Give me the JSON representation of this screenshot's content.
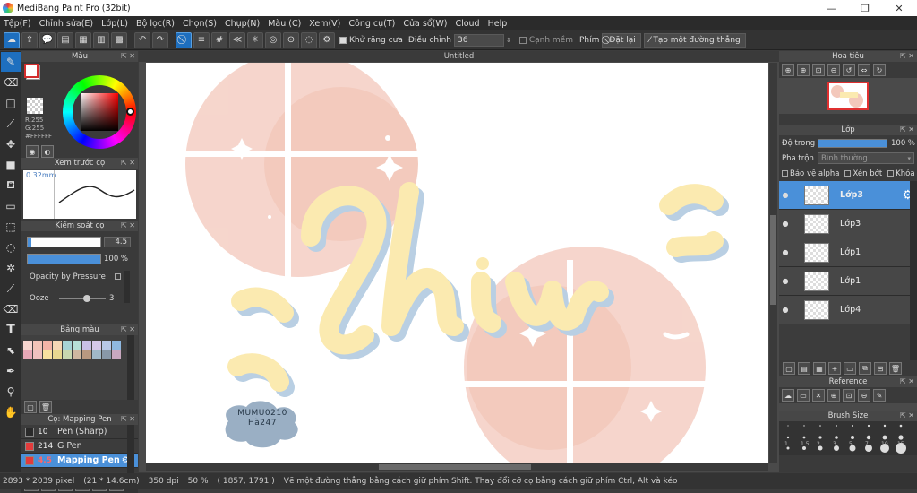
{
  "app": {
    "title": "MediBang Paint Pro (32bit)"
  },
  "menu": [
    "Tệp(F)",
    "Chỉnh sửa(E)",
    "Lớp(L)",
    "Bộ lọc(R)",
    "Chọn(S)",
    "Chụp(N)",
    "Màu (C)",
    "Xem(V)",
    "Công cụ(T)",
    "Cửa sổ(W)",
    "Cloud",
    "Help"
  ],
  "toolbar": {
    "antialias_label": "Khử răng cưa",
    "adjust_label": "Điều chỉnh",
    "adjust_value": "36",
    "edge_label": "Cạnh mềm",
    "key_label": "Phím",
    "reset_label": "Đặt lại",
    "line_label": "Tạo một đường thẳng"
  },
  "color_panel": {
    "title": "Màu",
    "r": "R:255",
    "g": "G:255",
    "hex": "#FFFFFF"
  },
  "brush_preview": {
    "title": "Xem trước cọ",
    "size": "0.32mm"
  },
  "brush_control": {
    "title": "Kiểm soát cọ",
    "size_value": "4.5",
    "opacity_value": "100 %",
    "pressure_label": "Opacity by Pressure",
    "ooze_label": "Ooze",
    "ooze_value": "3"
  },
  "palette": {
    "title": "Bảng màu",
    "colors": [
      "#f7d6d0",
      "#f2c4b8",
      "#f4b5a8",
      "#f6d7b5",
      "#a7d4d6",
      "#b6e0d8",
      "#c9c0e6",
      "#d6c8ea",
      "#b8c8e8",
      "#8fb8e0",
      "#e8a8b8",
      "#f0c0c0",
      "#f8e0a0",
      "#e8d890",
      "#c8d8b0",
      "#d0b8a0",
      "#b89880",
      "#a0b8c8",
      "#8898a8",
      "#c8a8c0"
    ]
  },
  "brushes": {
    "title": "Cọ: Mapping Pen",
    "items": [
      {
        "size": "10",
        "name": "Pen (Sharp)",
        "color": "#2a2a2a"
      },
      {
        "size": "214",
        "name": "G Pen",
        "color": "#e23b3b"
      },
      {
        "size": "4.5",
        "name": "Mapping Pen",
        "color": "#e23b3b"
      }
    ]
  },
  "document": {
    "tab_title": "Untitled",
    "watermark": [
      "MUMU0210",
      "Hà247"
    ]
  },
  "navigator": {
    "title": "Hoa tiêu"
  },
  "layers": {
    "title": "Lớp",
    "opacity_label": "Độ trong",
    "opacity_value": "100 %",
    "blend_label": "Pha trộn",
    "blend_value": "Bình thường",
    "protect_alpha": "Bảo vệ alpha",
    "clip": "Xén bớt",
    "lock": "Khóa",
    "items": [
      {
        "name": "Lớp3"
      },
      {
        "name": "Lớp3"
      },
      {
        "name": "Lớp1"
      },
      {
        "name": "Lớp1"
      },
      {
        "name": "Lớp4"
      }
    ]
  },
  "reference": {
    "title": "Reference"
  },
  "brush_size": {
    "title": "Brush Size",
    "sizes": [
      "1",
      "1.5",
      "2",
      "3",
      "5",
      "7",
      "10",
      "15"
    ]
  },
  "status": {
    "dims": "2893 * 2039 pixel",
    "physical": "(21 * 14.6cm)",
    "dpi": "350 dpi",
    "zoom": "50 %",
    "coords": "( 1857, 1791 )",
    "hint": "Vẽ một đường thẳng bằng cách giữ phím Shift. Thay đổi cỡ cọ bằng cách giữ phím Ctrl, Alt và kéo"
  }
}
